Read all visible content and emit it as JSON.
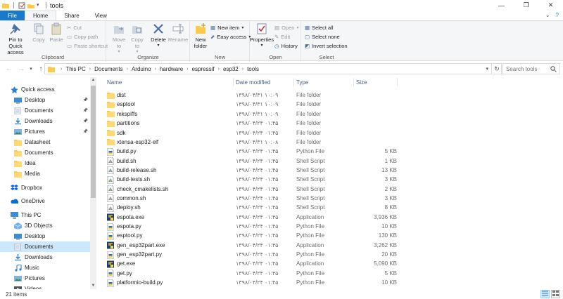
{
  "window": {
    "title": "tools",
    "controls": [
      "minimize-icon",
      "restore-icon",
      "close-icon"
    ]
  },
  "ribbon_tabs": [
    {
      "label": "File"
    },
    {
      "label": "Home"
    },
    {
      "label": "Share"
    },
    {
      "label": "View"
    }
  ],
  "ribbon": {
    "clipboard": {
      "label": "Clipboard",
      "pin": "Pin to Quick access",
      "copy": "Copy",
      "paste": "Paste",
      "cut": "Cut",
      "copy_path": "Copy path",
      "paste_shortcut": "Paste shortcut"
    },
    "organize": {
      "label": "Organize",
      "move_to": "Move to",
      "copy_to": "Copy to",
      "delete": "Delete",
      "rename": "Rename"
    },
    "new": {
      "label": "New",
      "new_folder": "New folder",
      "new_item": "New item",
      "easy_access": "Easy access"
    },
    "open": {
      "label": "Open",
      "properties": "Properties",
      "open": "Open",
      "edit": "Edit",
      "history": "History"
    },
    "select": {
      "label": "Select",
      "select_all": "Select all",
      "select_none": "Select none",
      "invert": "Invert selection"
    }
  },
  "address": {
    "crumbs": [
      "This PC",
      "Documents",
      "Arduino",
      "hardware",
      "espressif",
      "esp32",
      "tools"
    ],
    "search_placeholder": "Search tools"
  },
  "nav_pane": [
    {
      "label": "Quick access",
      "icon": "star-icon",
      "level": 0,
      "pinned": false
    },
    {
      "label": "Desktop",
      "icon": "desktop-icon",
      "level": 1,
      "pinned": true
    },
    {
      "label": "Documents",
      "icon": "documents-icon",
      "level": 1,
      "pinned": true
    },
    {
      "label": "Downloads",
      "icon": "downloads-icon",
      "level": 1,
      "pinned": true
    },
    {
      "label": "Pictures",
      "icon": "pictures-icon",
      "level": 1,
      "pinned": true
    },
    {
      "label": "Datasheet",
      "icon": "folder-icon",
      "level": 1,
      "pinned": false
    },
    {
      "label": "Documents",
      "icon": "folder-icon",
      "level": 1,
      "pinned": false
    },
    {
      "label": "Idea",
      "icon": "folder-icon",
      "level": 1,
      "pinned": false
    },
    {
      "label": "Media",
      "icon": "folder-icon",
      "level": 1,
      "pinned": false
    },
    {
      "label": "Dropbox",
      "icon": "dropbox-icon",
      "level": 0,
      "pinned": false
    },
    {
      "label": "OneDrive",
      "icon": "onedrive-icon",
      "level": 0,
      "pinned": false
    },
    {
      "label": "This PC",
      "icon": "pc-icon",
      "level": 0,
      "pinned": false
    },
    {
      "label": "3D Objects",
      "icon": "objects3d-icon",
      "level": 1,
      "pinned": false
    },
    {
      "label": "Desktop",
      "icon": "desktop-icon",
      "level": 1,
      "pinned": false
    },
    {
      "label": "Documents",
      "icon": "documents-icon",
      "level": 1,
      "pinned": false,
      "selected": true
    },
    {
      "label": "Downloads",
      "icon": "downloads-icon",
      "level": 1,
      "pinned": false
    },
    {
      "label": "Music",
      "icon": "music-icon",
      "level": 1,
      "pinned": false
    },
    {
      "label": "Pictures",
      "icon": "pictures-icon",
      "level": 1,
      "pinned": false
    },
    {
      "label": "Videos",
      "icon": "videos-icon",
      "level": 1,
      "pinned": false
    }
  ],
  "columns": {
    "name": "Name",
    "date": "Date modified",
    "type": "Type",
    "size": "Size"
  },
  "files": [
    {
      "name": "dist",
      "date": "۱۳۹۸/۰۴/۳۱ ۱۰:۰۹",
      "type": "File folder",
      "size": "",
      "icon": "folder-icon"
    },
    {
      "name": "esptool",
      "date": "۱۳۹۸/۰۴/۳۱ ۱۰:۰۹",
      "type": "File folder",
      "size": "",
      "icon": "folder-icon"
    },
    {
      "name": "mkspiffs",
      "date": "۱۳۹۸/۰۴/۳۱ ۱۰:۰۹",
      "type": "File folder",
      "size": "",
      "icon": "folder-icon"
    },
    {
      "name": "partitions",
      "date": "۱۳۹۸/۰۴/۲۴ ۰۱:۴۵",
      "type": "File folder",
      "size": "",
      "icon": "folder-icon"
    },
    {
      "name": "sdk",
      "date": "۱۳۹۸/۰۴/۲۴ ۰۱:۴۵",
      "type": "File folder",
      "size": "",
      "icon": "folder-icon"
    },
    {
      "name": "xtensa-esp32-elf",
      "date": "۱۳۹۸/۰۴/۳۱ ۱۰:۰۸",
      "type": "File folder",
      "size": "",
      "icon": "folder-icon"
    },
    {
      "name": "build.py",
      "date": "۱۳۹۸/۰۴/۲۴ ۰۱:۴۵",
      "type": "Python File",
      "size": "5 KB",
      "icon": "python-file-icon"
    },
    {
      "name": "build.sh",
      "date": "۱۳۹۸/۰۴/۲۴ ۰۱:۴۵",
      "type": "Shell Script",
      "size": "1 KB",
      "icon": "shell-script-icon"
    },
    {
      "name": "build-release.sh",
      "date": "۱۳۹۸/۰۴/۲۴ ۰۱:۴۵",
      "type": "Shell Script",
      "size": "13 KB",
      "icon": "shell-script-icon"
    },
    {
      "name": "build-tests.sh",
      "date": "۱۳۹۸/۰۴/۲۴ ۰۱:۴۵",
      "type": "Shell Script",
      "size": "3 KB",
      "icon": "shell-script-icon"
    },
    {
      "name": "check_cmakelists.sh",
      "date": "۱۳۹۸/۰۴/۲۴ ۰۱:۴۵",
      "type": "Shell Script",
      "size": "2 KB",
      "icon": "shell-script-icon"
    },
    {
      "name": "common.sh",
      "date": "۱۳۹۸/۰۴/۲۴ ۰۱:۴۵",
      "type": "Shell Script",
      "size": "3 KB",
      "icon": "shell-script-icon"
    },
    {
      "name": "deploy.sh",
      "date": "۱۳۹۸/۰۴/۲۴ ۰۱:۴۵",
      "type": "Shell Script",
      "size": "8 KB",
      "icon": "shell-script-icon"
    },
    {
      "name": "espota.exe",
      "date": "۱۳۹۸/۰۴/۲۴ ۰۱:۴۵",
      "type": "Application",
      "size": "3,936 KB",
      "icon": "application-icon"
    },
    {
      "name": "espota.py",
      "date": "۱۳۹۸/۰۴/۲۴ ۰۱:۴۵",
      "type": "Python File",
      "size": "10 KB",
      "icon": "python-file-icon"
    },
    {
      "name": "esptool.py",
      "date": "۱۳۹۸/۰۴/۲۴ ۰۱:۴۵",
      "type": "Python File",
      "size": "130 KB",
      "icon": "python-file-icon"
    },
    {
      "name": "gen_esp32part.exe",
      "date": "۱۳۹۸/۰۴/۲۴ ۰۱:۴۵",
      "type": "Application",
      "size": "3,262 KB",
      "icon": "application-icon"
    },
    {
      "name": "gen_esp32part.py",
      "date": "۱۳۹۸/۰۴/۲۴ ۰۱:۴۵",
      "type": "Python File",
      "size": "20 KB",
      "icon": "python-file-icon"
    },
    {
      "name": "get.exe",
      "date": "۱۳۹۸/۰۴/۲۴ ۰۱:۴۵",
      "type": "Application",
      "size": "5,090 KB",
      "icon": "application-icon"
    },
    {
      "name": "get.py",
      "date": "۱۳۹۸/۰۴/۲۴ ۰۱:۴۵",
      "type": "Python File",
      "size": "5 KB",
      "icon": "python-file-icon"
    },
    {
      "name": "platformio-build.py",
      "date": "۱۳۹۸/۰۴/۲۴ ۰۱:۴۵",
      "type": "Python File",
      "size": "10 KB",
      "icon": "python-file-icon"
    }
  ],
  "status": {
    "item_count": "21 items"
  },
  "colors": {
    "accent": "#1979ca",
    "folder": "#ffc94a",
    "selection": "#cce8ff"
  }
}
